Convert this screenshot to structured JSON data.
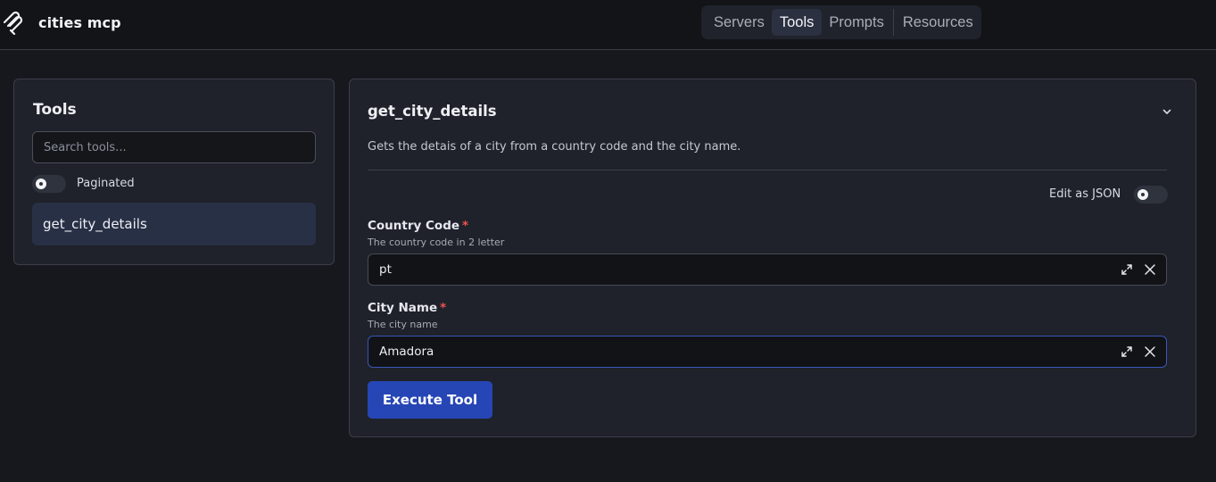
{
  "app": {
    "title": "cities mcp",
    "logo_icon": "mcp-logo-icon"
  },
  "nav": {
    "tabs": [
      {
        "label": "Servers",
        "active": false
      },
      {
        "label": "Tools",
        "active": true
      },
      {
        "label": "Prompts",
        "active": false
      },
      {
        "label": "Resources",
        "active": false
      }
    ]
  },
  "tools_panel": {
    "heading": "Tools",
    "search_placeholder": "Search tools...",
    "paginated_label": "Paginated",
    "paginated_on": false,
    "items": [
      {
        "label": "get_city_details",
        "selected": true
      }
    ]
  },
  "tool_detail": {
    "name": "get_city_details",
    "description": "Gets the detais of a city from a country code and the city name.",
    "edit_json_label": "Edit as JSON",
    "edit_json_on": false,
    "required_marker": "*",
    "fields": [
      {
        "label": "Country Code",
        "hint": "The country code in 2 letter",
        "value": "pt",
        "required": true,
        "focused": false
      },
      {
        "label": "City Name",
        "hint": "The city name",
        "value": "Amadora",
        "required": true,
        "focused": true
      }
    ],
    "execute_label": "Execute Tool"
  },
  "colors": {
    "background": "#16181d",
    "panel": "#1f222a",
    "accent": "#2646b5",
    "required": "#f05252",
    "selected_item": "#283046"
  }
}
